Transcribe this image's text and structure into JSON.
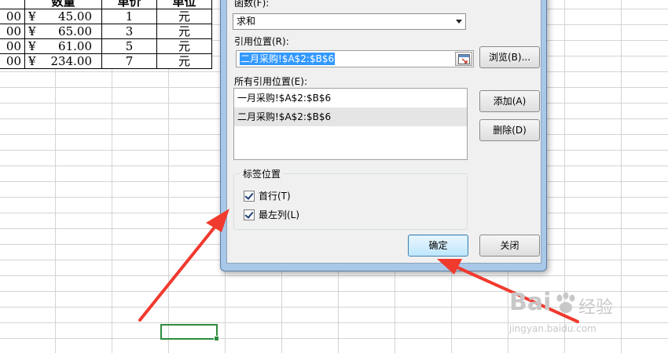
{
  "sheet": {
    "headers": [
      "数量",
      "单价",
      "单位"
    ],
    "rows": [
      {
        "a": "00",
        "currency": "¥",
        "qty": "45.00",
        "price": "1",
        "unit": "元"
      },
      {
        "a": "00",
        "currency": "¥",
        "qty": "65.00",
        "price": "3",
        "unit": "元"
      },
      {
        "a": "00",
        "currency": "¥",
        "qty": "61.00",
        "price": "5",
        "unit": "元"
      },
      {
        "a": "00",
        "currency": "¥",
        "qty": "234.00",
        "price": "7",
        "unit": "元"
      }
    ]
  },
  "dialog": {
    "function_label": "函数(F):",
    "function_value": "求和",
    "reference_label": "引用位置(R):",
    "reference_value": "二月采购!$A$2:$B$6",
    "browse_button": "浏览(B)...",
    "all_refs_label": "所有引用位置(E):",
    "all_refs": [
      "一月采购!$A$2:$B$6",
      "二月采购!$A$2:$B$6"
    ],
    "add_button": "添加(A)",
    "delete_button": "删除(D)",
    "label_group_title": "标签位置",
    "first_row_label": "首行(T)",
    "first_row_checked": true,
    "left_col_label": "最左列(L)",
    "left_col_checked": true,
    "ok_button": "确定",
    "close_button": "关闭"
  },
  "annotation": {
    "arrow_color": "#f03a2e"
  },
  "watermark": {
    "brand": "Bai",
    "brand_cn": "经验",
    "url": "jingyan.baidu.com"
  }
}
